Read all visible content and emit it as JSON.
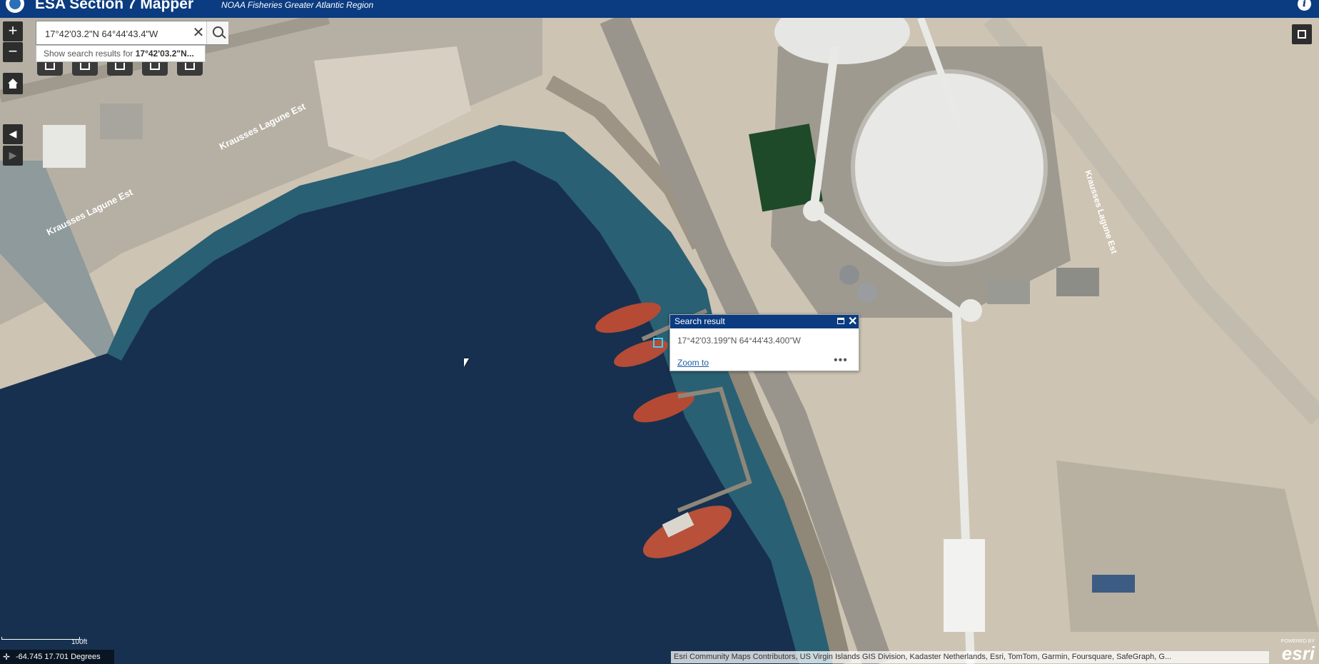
{
  "header": {
    "title": "ESA Section 7 Mapper",
    "subtitle": "NOAA Fisheries Greater Atlantic Region"
  },
  "controls": {
    "zoom_in": "+",
    "zoom_out": "−",
    "back": "◀",
    "forward": "▶"
  },
  "search": {
    "value": "17°42'03.2\"N 64°44'43.4\"W",
    "clear": "✕",
    "suggestion_prefix": "Show search results for ",
    "suggestion_term": "17°42'03.2\"N..."
  },
  "map_labels": {
    "road_1": "Krausses Lagune Est",
    "road_2": "Krausses Lagune Est",
    "road_3": "Krausses Lagune Est"
  },
  "popup": {
    "title": "Search result",
    "coordinates": "17°42'03.199\"N 64°44'43.400\"W",
    "zoom_to": "Zoom to",
    "more": "•••",
    "close": "✕"
  },
  "footer": {
    "scale": "100ft",
    "coordinates": "-64.745 17.701 Degrees",
    "attribution": "Esri Community Maps Contributors, US Virgin Islands GIS Division, Kadaster Netherlands, Esri, TomTom, Garmin, Foursquare, SafeGraph, G...",
    "powered_by": "POWERED BY",
    "esri": "esri"
  },
  "colors": {
    "header": "#0b3b80",
    "water": "#17304f",
    "land": "#cfc6b5",
    "pointer": "#3bd1f3"
  }
}
